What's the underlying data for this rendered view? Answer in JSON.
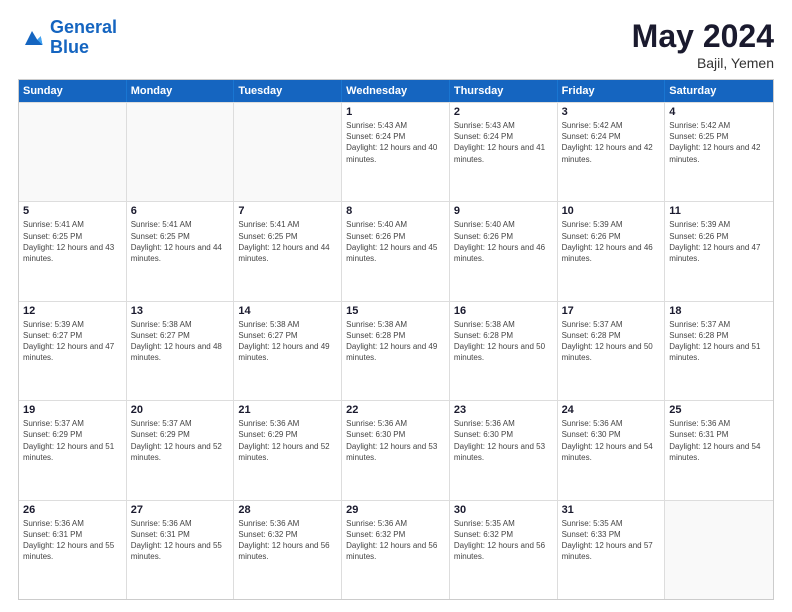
{
  "logo": {
    "line1": "General",
    "line2": "Blue"
  },
  "title": "May 2024",
  "location": "Bajil, Yemen",
  "header_days": [
    "Sunday",
    "Monday",
    "Tuesday",
    "Wednesday",
    "Thursday",
    "Friday",
    "Saturday"
  ],
  "weeks": [
    [
      {
        "day": "",
        "sunrise": "",
        "sunset": "",
        "daylight": ""
      },
      {
        "day": "",
        "sunrise": "",
        "sunset": "",
        "daylight": ""
      },
      {
        "day": "",
        "sunrise": "",
        "sunset": "",
        "daylight": ""
      },
      {
        "day": "1",
        "sunrise": "Sunrise: 5:43 AM",
        "sunset": "Sunset: 6:24 PM",
        "daylight": "Daylight: 12 hours and 40 minutes."
      },
      {
        "day": "2",
        "sunrise": "Sunrise: 5:43 AM",
        "sunset": "Sunset: 6:24 PM",
        "daylight": "Daylight: 12 hours and 41 minutes."
      },
      {
        "day": "3",
        "sunrise": "Sunrise: 5:42 AM",
        "sunset": "Sunset: 6:24 PM",
        "daylight": "Daylight: 12 hours and 42 minutes."
      },
      {
        "day": "4",
        "sunrise": "Sunrise: 5:42 AM",
        "sunset": "Sunset: 6:25 PM",
        "daylight": "Daylight: 12 hours and 42 minutes."
      }
    ],
    [
      {
        "day": "5",
        "sunrise": "Sunrise: 5:41 AM",
        "sunset": "Sunset: 6:25 PM",
        "daylight": "Daylight: 12 hours and 43 minutes."
      },
      {
        "day": "6",
        "sunrise": "Sunrise: 5:41 AM",
        "sunset": "Sunset: 6:25 PM",
        "daylight": "Daylight: 12 hours and 44 minutes."
      },
      {
        "day": "7",
        "sunrise": "Sunrise: 5:41 AM",
        "sunset": "Sunset: 6:25 PM",
        "daylight": "Daylight: 12 hours and 44 minutes."
      },
      {
        "day": "8",
        "sunrise": "Sunrise: 5:40 AM",
        "sunset": "Sunset: 6:26 PM",
        "daylight": "Daylight: 12 hours and 45 minutes."
      },
      {
        "day": "9",
        "sunrise": "Sunrise: 5:40 AM",
        "sunset": "Sunset: 6:26 PM",
        "daylight": "Daylight: 12 hours and 46 minutes."
      },
      {
        "day": "10",
        "sunrise": "Sunrise: 5:39 AM",
        "sunset": "Sunset: 6:26 PM",
        "daylight": "Daylight: 12 hours and 46 minutes."
      },
      {
        "day": "11",
        "sunrise": "Sunrise: 5:39 AM",
        "sunset": "Sunset: 6:26 PM",
        "daylight": "Daylight: 12 hours and 47 minutes."
      }
    ],
    [
      {
        "day": "12",
        "sunrise": "Sunrise: 5:39 AM",
        "sunset": "Sunset: 6:27 PM",
        "daylight": "Daylight: 12 hours and 47 minutes."
      },
      {
        "day": "13",
        "sunrise": "Sunrise: 5:38 AM",
        "sunset": "Sunset: 6:27 PM",
        "daylight": "Daylight: 12 hours and 48 minutes."
      },
      {
        "day": "14",
        "sunrise": "Sunrise: 5:38 AM",
        "sunset": "Sunset: 6:27 PM",
        "daylight": "Daylight: 12 hours and 49 minutes."
      },
      {
        "day": "15",
        "sunrise": "Sunrise: 5:38 AM",
        "sunset": "Sunset: 6:28 PM",
        "daylight": "Daylight: 12 hours and 49 minutes."
      },
      {
        "day": "16",
        "sunrise": "Sunrise: 5:38 AM",
        "sunset": "Sunset: 6:28 PM",
        "daylight": "Daylight: 12 hours and 50 minutes."
      },
      {
        "day": "17",
        "sunrise": "Sunrise: 5:37 AM",
        "sunset": "Sunset: 6:28 PM",
        "daylight": "Daylight: 12 hours and 50 minutes."
      },
      {
        "day": "18",
        "sunrise": "Sunrise: 5:37 AM",
        "sunset": "Sunset: 6:28 PM",
        "daylight": "Daylight: 12 hours and 51 minutes."
      }
    ],
    [
      {
        "day": "19",
        "sunrise": "Sunrise: 5:37 AM",
        "sunset": "Sunset: 6:29 PM",
        "daylight": "Daylight: 12 hours and 51 minutes."
      },
      {
        "day": "20",
        "sunrise": "Sunrise: 5:37 AM",
        "sunset": "Sunset: 6:29 PM",
        "daylight": "Daylight: 12 hours and 52 minutes."
      },
      {
        "day": "21",
        "sunrise": "Sunrise: 5:36 AM",
        "sunset": "Sunset: 6:29 PM",
        "daylight": "Daylight: 12 hours and 52 minutes."
      },
      {
        "day": "22",
        "sunrise": "Sunrise: 5:36 AM",
        "sunset": "Sunset: 6:30 PM",
        "daylight": "Daylight: 12 hours and 53 minutes."
      },
      {
        "day": "23",
        "sunrise": "Sunrise: 5:36 AM",
        "sunset": "Sunset: 6:30 PM",
        "daylight": "Daylight: 12 hours and 53 minutes."
      },
      {
        "day": "24",
        "sunrise": "Sunrise: 5:36 AM",
        "sunset": "Sunset: 6:30 PM",
        "daylight": "Daylight: 12 hours and 54 minutes."
      },
      {
        "day": "25",
        "sunrise": "Sunrise: 5:36 AM",
        "sunset": "Sunset: 6:31 PM",
        "daylight": "Daylight: 12 hours and 54 minutes."
      }
    ],
    [
      {
        "day": "26",
        "sunrise": "Sunrise: 5:36 AM",
        "sunset": "Sunset: 6:31 PM",
        "daylight": "Daylight: 12 hours and 55 minutes."
      },
      {
        "day": "27",
        "sunrise": "Sunrise: 5:36 AM",
        "sunset": "Sunset: 6:31 PM",
        "daylight": "Daylight: 12 hours and 55 minutes."
      },
      {
        "day": "28",
        "sunrise": "Sunrise: 5:36 AM",
        "sunset": "Sunset: 6:32 PM",
        "daylight": "Daylight: 12 hours and 56 minutes."
      },
      {
        "day": "29",
        "sunrise": "Sunrise: 5:36 AM",
        "sunset": "Sunset: 6:32 PM",
        "daylight": "Daylight: 12 hours and 56 minutes."
      },
      {
        "day": "30",
        "sunrise": "Sunrise: 5:35 AM",
        "sunset": "Sunset: 6:32 PM",
        "daylight": "Daylight: 12 hours and 56 minutes."
      },
      {
        "day": "31",
        "sunrise": "Sunrise: 5:35 AM",
        "sunset": "Sunset: 6:33 PM",
        "daylight": "Daylight: 12 hours and 57 minutes."
      },
      {
        "day": "",
        "sunrise": "",
        "sunset": "",
        "daylight": ""
      }
    ]
  ]
}
